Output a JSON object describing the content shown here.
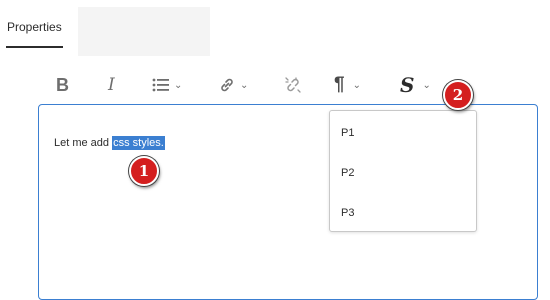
{
  "tabs": {
    "properties_label": "Properties"
  },
  "toolbar": {
    "bold_label": "B",
    "italic_label": "I",
    "chevron": "⌄",
    "paragraph_label": "¶",
    "style_label": "S",
    "icons": [
      "bold-icon",
      "italic-icon",
      "list-icon",
      "link-icon",
      "unlink-icon",
      "paragraph-icon",
      "style-icon"
    ]
  },
  "editor": {
    "text_before": "Let me add ",
    "selected_text": "css styles.",
    "selection_color": "#3b7fd1"
  },
  "dropdown": {
    "items": [
      "P1",
      "P2",
      "P3"
    ]
  },
  "markers": [
    "1",
    "2"
  ],
  "colors": {
    "accent": "#3b7fd1",
    "marker": "#d41f1f"
  }
}
